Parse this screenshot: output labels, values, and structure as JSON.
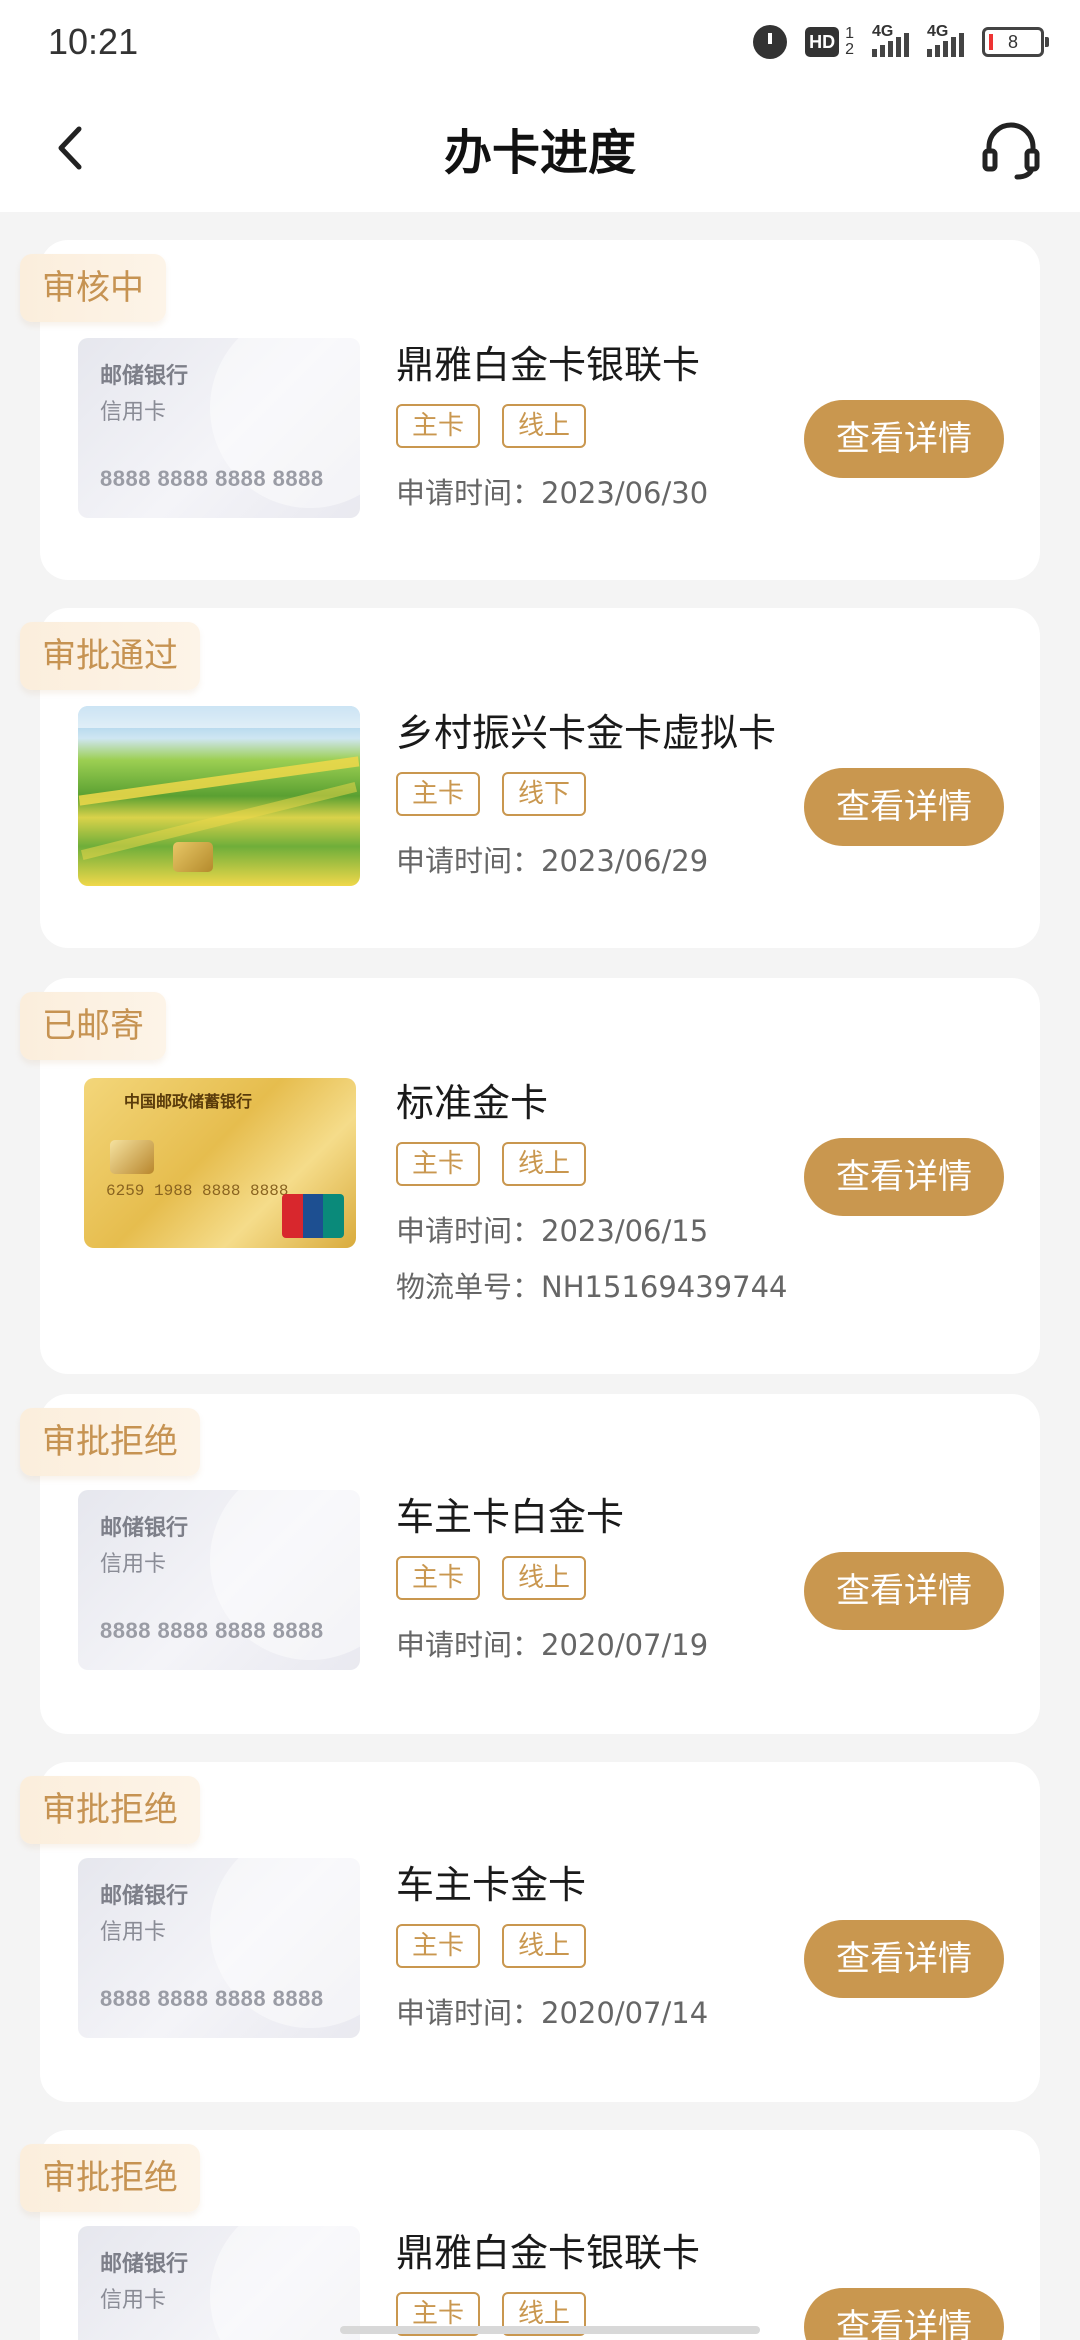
{
  "status_bar": {
    "time": "10:21",
    "hd": "HD",
    "sim1": "1",
    "sim2": "2",
    "net1": "4G",
    "net2": "4G",
    "battery": "8"
  },
  "header": {
    "title": "办卡进度",
    "back_icon": "chevron-left-icon",
    "support_icon": "headset-icon"
  },
  "placeholder": {
    "bank": "邮储银行",
    "type": "信用卡",
    "number": "8888 8888 8888 8888"
  },
  "gold_card_bank": "中国邮政储蓄银行",
  "gold_card_number": "6259 1988 8888 8888",
  "labels": {
    "apply_time": "申请时间：",
    "tracking": "物流单号：",
    "detail_button": "查看详情"
  },
  "applications": [
    {
      "status": "审核中",
      "name": "鼎雅白金卡银联卡",
      "tag1": "主卡",
      "tag2": "线上",
      "date": "2023/06/30"
    },
    {
      "status": "审批通过",
      "name": "乡村振兴卡金卡虚拟卡",
      "tag1": "主卡",
      "tag2": "线下",
      "date": "2023/06/29"
    },
    {
      "status": "已邮寄",
      "name": "标准金卡",
      "tag1": "主卡",
      "tag2": "线上",
      "date": "2023/06/15",
      "tracking_no": "NH15169439744"
    },
    {
      "status": "审批拒绝",
      "name": "车主卡白金卡",
      "tag1": "主卡",
      "tag2": "线上",
      "date": "2020/07/19"
    },
    {
      "status": "审批拒绝",
      "name": "车主卡金卡",
      "tag1": "主卡",
      "tag2": "线上",
      "date": "2020/07/14"
    },
    {
      "status": "审批拒绝",
      "name": "鼎雅白金卡银联卡",
      "tag1": "主卡",
      "tag2": "线上"
    }
  ],
  "colors": {
    "accent": "#c9974f",
    "status_text": "#c69352",
    "status_bg": "#fbeedc",
    "page_bg": "#f4f4f4"
  }
}
